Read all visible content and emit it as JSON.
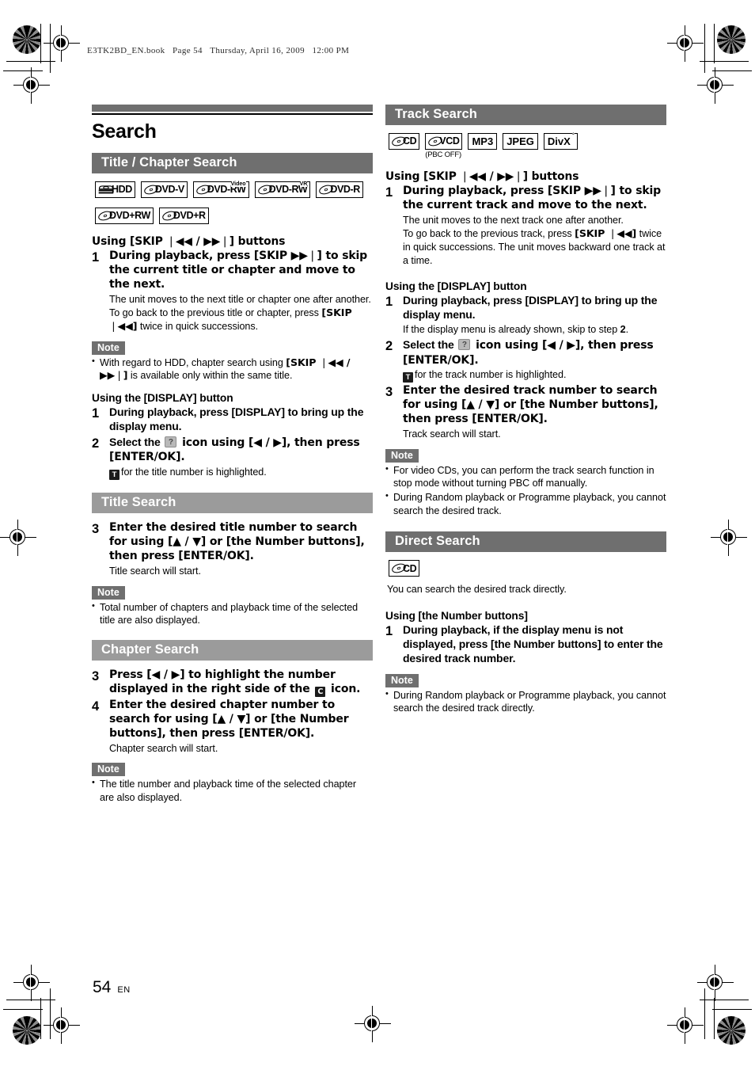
{
  "runhead": "E3TK2BD_EN.book   Page 54   Thursday, April 16, 2009   12:00 PM",
  "page_title": "Search",
  "footer": {
    "page_number": "54",
    "language": "EN"
  },
  "colors": {
    "bar_dark": "#6f6f6f",
    "bar_light": "#9b9b9b",
    "text": "#000000"
  },
  "left_column": {
    "section_title": "Title / Chapter Search",
    "logos": [
      {
        "text": "HDD",
        "kind": "hdd"
      },
      {
        "text": "DVD-V",
        "kind": "disc"
      },
      {
        "text": "DVD-RW",
        "kind": "disc",
        "sup": "Video"
      },
      {
        "text": "DVD-RW",
        "kind": "disc",
        "sup": "VR"
      },
      {
        "text": "DVD-R",
        "kind": "disc"
      },
      {
        "text": "DVD+RW",
        "kind": "disc"
      },
      {
        "text": "DVD+R",
        "kind": "disc"
      }
    ],
    "skip_heading": "Using [SKIP ❘◀◀ / ▶▶❘] buttons",
    "skip_step1_num": "1",
    "skip_step1_lead": "During playback, press [SKIP ▶▶❘] to skip the current title or chapter and move to the next.",
    "skip_step1_sub_a": "The unit moves to the next title or chapter one after another.",
    "skip_step1_sub_b_pre": "To go back to the previous title or chapter, press ",
    "skip_step1_sub_b_bold": "[SKIP ❘◀◀]",
    "skip_step1_sub_b_post": " twice in quick successions.",
    "note_label": "Note",
    "skip_note_pre": "With regard to HDD, chapter search using ",
    "skip_note_bold": "[SKIP ❘◀◀ / ▶▶❘]",
    "skip_note_post": " is available only within the same title.",
    "display_heading": "Using the [DISPLAY] button",
    "display_step1_num": "1",
    "display_step1_lead": "During playback, press [DISPLAY] to bring up the display menu.",
    "display_step2_num": "2",
    "display_step2_lead_pre": "Select the ",
    "display_step2_icon": "search-icon",
    "display_step2_lead_post": " icon using [◀ / ▶], then press [ENTER/OK].",
    "display_step2_sub_badge": "T",
    "display_step2_sub": "for the title number is highlighted.",
    "title_search_bar": "Title Search",
    "title_step3_num": "3",
    "title_step3_lead": "Enter the desired title number to search for using [▲ / ▼] or [the Number buttons], then press [ENTER/OK].",
    "title_step3_sub": "Title search will start.",
    "title_note": "Total number of chapters and playback time of the selected title are also displayed.",
    "chapter_search_bar": "Chapter Search",
    "chapter_step3_num": "3",
    "chapter_step3_lead_pre": "Press [◀ / ▶] to highlight the number displayed in the right side of the ",
    "chapter_step3_badge": "C",
    "chapter_step3_lead_post": " icon.",
    "chapter_step4_num": "4",
    "chapter_step4_lead": "Enter the desired chapter number to search for using [▲ / ▼] or [the Number buttons], then press [ENTER/OK].",
    "chapter_step4_sub": "Chapter search will start.",
    "chapter_note": "The title number and playback time of the selected chapter are also displayed."
  },
  "right_column": {
    "section_title": "Track Search",
    "logos": [
      {
        "text": "CD",
        "kind": "disc"
      },
      {
        "text": "VCD",
        "kind": "disc",
        "caption": "(PBC OFF)"
      },
      {
        "text": "MP3",
        "kind": "plain"
      },
      {
        "text": "JPEG",
        "kind": "plain"
      },
      {
        "text": "DivX",
        "kind": "plain",
        "sup": "°"
      }
    ],
    "skip_heading": "Using [SKIP ❘◀◀ / ▶▶❘] buttons",
    "skip_step1_num": "1",
    "skip_step1_lead": "During playback, press [SKIP ▶▶❘] to skip the current track and move to the next.",
    "skip_step1_sub_a": "The unit moves to the next track one after another.",
    "skip_step1_sub_b_pre": "To go back to the previous track, press ",
    "skip_step1_sub_b_bold": "[SKIP ❘◀◀]",
    "skip_step1_sub_b_post": " twice in quick successions. The unit moves backward one track at a time.",
    "display_heading": "Using the [DISPLAY] button",
    "display_step1_num": "1",
    "display_step1_lead": "During playback, press [DISPLAY] to bring up the display menu.",
    "display_step1_sub_pre": "If the display menu is already shown, skip to step ",
    "display_step1_sub_bold": "2",
    "display_step1_sub_post": ".",
    "display_step2_num": "2",
    "display_step2_lead_pre": "Select the ",
    "display_step2_lead_post": " icon using [◀ / ▶], then press [ENTER/OK].",
    "display_step2_sub_badge": "T",
    "display_step2_sub": "for the track number is highlighted.",
    "display_step3_num": "3",
    "display_step3_lead": "Enter the desired track number to search for using [▲ / ▼] or [the Number buttons], then press [ENTER/OK].",
    "display_step3_sub": "Track search will start.",
    "note_label": "Note",
    "track_note_1": "For video CDs, you can perform the track search function in stop mode without turning PBC off manually.",
    "track_note_2": "During Random playback or Programme playback, you cannot search the desired track.",
    "direct_search_bar": "Direct Search",
    "direct_intro": "You can search the desired track directly.",
    "direct_heading": "Using [the Number buttons]",
    "direct_step1_num": "1",
    "direct_step1_lead": "During playback, if the display menu is not displayed, press [the Number buttons] to enter the desired track number.",
    "direct_note": "During Random playback or Programme playback, you cannot search the desired track directly."
  }
}
